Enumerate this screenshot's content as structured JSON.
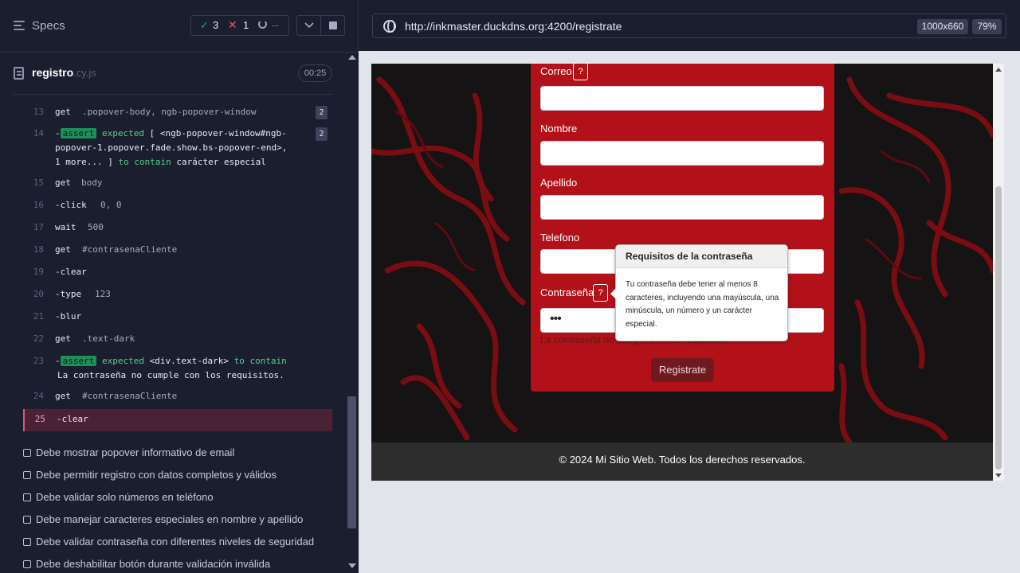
{
  "reporter": {
    "header": {
      "specs_label": "Specs",
      "passed": "3",
      "failed": "1",
      "pending": "--"
    },
    "spec_file": {
      "name": "registro",
      "ext": ".cy.js",
      "timer": "00:25"
    },
    "commands": [
      {
        "num": "13",
        "name": "get",
        "arg": ".popover-body, ngb-popover-window",
        "badge": "2"
      },
      {
        "num": "14",
        "assert": "assert",
        "expected": "expected",
        "subject_l1": "[ <ngb-popover-window#ngb-",
        "subject_l2": "popover-1.popover.fade.show.bs-popover-end>,",
        "more": "1 more... ]",
        "to_contain": "to contain",
        "value": "carácter especial",
        "badge": "2"
      },
      {
        "num": "15",
        "name": "get",
        "arg": "body"
      },
      {
        "num": "16",
        "name": "-click",
        "arg": "0, 0"
      },
      {
        "num": "17",
        "name": "wait",
        "arg": "500"
      },
      {
        "num": "18",
        "name": "get",
        "arg": "#contrasenaCliente"
      },
      {
        "num": "19",
        "name": "-clear",
        "arg": ""
      },
      {
        "num": "20",
        "name": "-type",
        "arg": "123"
      },
      {
        "num": "21",
        "name": "-blur",
        "arg": ""
      },
      {
        "num": "22",
        "name": "get",
        "arg": ".text-dark"
      },
      {
        "num": "23",
        "assert": "assert",
        "expected": "expected",
        "subject": "<div.text-dark>",
        "to_contain": "to contain",
        "value": "La contraseña no cumple con los requisitos."
      },
      {
        "num": "24",
        "name": "get",
        "arg": "#contrasenaCliente"
      },
      {
        "num": "25",
        "name": "-clear",
        "arg": ""
      }
    ],
    "tests": [
      "Debe mostrar popover informativo de email",
      "Debe permitir registro con datos completos y válidos",
      "Debe validar solo números en teléfono",
      "Debe manejar caracteres especiales en nombre y apellido",
      "Debe validar contraseña con diferentes niveles de seguridad",
      "Debe deshabilitar botón durante validación inválida"
    ]
  },
  "aut": {
    "url": "http://inkmaster.duckdns.org:4200/registrate",
    "viewport": "1000x660",
    "zoom": "79%",
    "form": {
      "correo_label": "Correo",
      "nombre_label": "Nombre",
      "apellido_label": "Apellido",
      "telefono_label": "Telefono",
      "contrasena_label": "Contraseña",
      "help_symbol": "?",
      "password_value": "•••",
      "error_text": "La contraseña no cumple con los requisitos.",
      "submit_label": "Registrate"
    },
    "popover": {
      "title": "Requisitos de la contraseña",
      "body": "Tu contraseña debe tener al menos 8 caracteres, incluyendo una mayúscula, una minúscula, un número y un carácter especial."
    },
    "footer": "© 2024 Mi Sitio Web. Todos los derechos reservados."
  },
  "colors": {
    "form_red": "#b3111a",
    "pass_green": "#1fa971",
    "fail_red": "#e45770",
    "assert_green": "#1f8f5a"
  }
}
